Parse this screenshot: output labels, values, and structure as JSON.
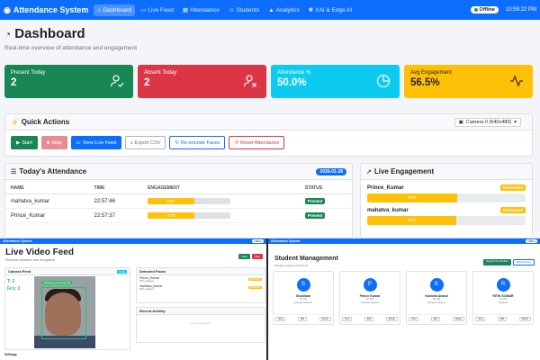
{
  "navbar": {
    "brand": "Attendance System",
    "items": [
      {
        "label": "Dashboard",
        "icon": "home-icon",
        "active": true
      },
      {
        "label": "Live Feed",
        "icon": "video-icon"
      },
      {
        "label": "Attendance",
        "icon": "calendar-icon"
      },
      {
        "label": "Students",
        "icon": "users-icon"
      },
      {
        "label": "Analytics",
        "icon": "chart-icon"
      },
      {
        "label": "XAI & Edge AI",
        "icon": "brain-icon"
      }
    ],
    "status": "Offline",
    "time": "10:59:22 PM"
  },
  "header": {
    "title": "Dashboard",
    "subtitle": "Real-time overview of attendance and engagement"
  },
  "stats": [
    {
      "label": "Present Today",
      "value": "2",
      "icon": "user-check-icon",
      "color": "#198754"
    },
    {
      "label": "Absent Today",
      "value": "2",
      "icon": "user-x-icon",
      "color": "#dc3545"
    },
    {
      "label": "Attendance %",
      "value": "50.0%",
      "icon": "pie-chart-icon",
      "color": "#0dcaf0"
    },
    {
      "label": "Avg Engagement",
      "value": "56.5%",
      "icon": "activity-icon",
      "color": "#ffc107"
    }
  ],
  "quick_actions": {
    "title": "Quick Actions",
    "camera_select": "Camera 0 (640x480)",
    "buttons": [
      "Start",
      "Stop",
      "View Live Feed",
      "Export CSV",
      "Re-encode Faces",
      "Reset Attendance"
    ]
  },
  "attendance": {
    "title": "Today's Attendance",
    "date": "2026-01-28",
    "columns": [
      "NAME",
      "TIME",
      "ENGAGEMENT",
      "STATUS"
    ],
    "rows": [
      {
        "name": "mahatva_kumar",
        "time": "22:57:46",
        "engagement": 56,
        "engagement_label": "56%",
        "status": "Present"
      },
      {
        "name": "Prince_Kumar",
        "time": "22:57:37",
        "engagement": 57,
        "engagement_label": "57%",
        "status": "Present"
      }
    ]
  },
  "live_engagement": {
    "title": "Live Engagement",
    "rows": [
      {
        "name": "Prince_Kumar",
        "status": "Distracted",
        "value": 57,
        "label": "57%"
      },
      {
        "name": "mahatva_kumar",
        "status": "Distracted",
        "value": 56,
        "label": "56%"
      }
    ]
  },
  "overlay_live": {
    "nav_brand": "Attendance System",
    "title": "Live Video Feed",
    "subtitle": "Real-time detection and recognition",
    "start": "Start",
    "stop": "Stop",
    "camera_title": "Camera Feed",
    "camera_tag": "LIVE",
    "face_label": "mahatva_kumar (0.76)",
    "overlay_line1": "T: 2",
    "overlay_line2": "Fcs: 2",
    "detected_title": "Detected Faces",
    "detected": [
      {
        "name": "Prince_Kumar",
        "sub": "55% engaged",
        "state": "Distracted"
      },
      {
        "name": "mahatva_kumar",
        "sub": "56% engaged",
        "state": "Distracted"
      }
    ],
    "activity_title": "Recent Activity",
    "activity_empty": "No recent activity",
    "settings": "Settings"
  },
  "overlay_students": {
    "nav_brand": "Attendance System",
    "title": "Student Management",
    "subtitle": "Manage registered students",
    "btn_register": "Register New Student",
    "btn_refresh": "Refresh Faces",
    "students": [
      {
        "initial": "S",
        "name": "Shubham",
        "meta1": "ID: 001",
        "meta2": "Computer Science"
      },
      {
        "initial": "P",
        "name": "Prince Kumar",
        "meta1": "ID: 002",
        "meta2": "Computer Science"
      },
      {
        "initial": "K",
        "name": "Kanishk Anand",
        "meta1": "ID: 003",
        "meta2": "Computer Science"
      },
      {
        "initial": "R",
        "name": "RITIK KUMAR",
        "meta1": "ID: 004",
        "meta2": "Computer"
      }
    ],
    "card_actions": [
      "View",
      "Edit",
      "Delete"
    ]
  }
}
